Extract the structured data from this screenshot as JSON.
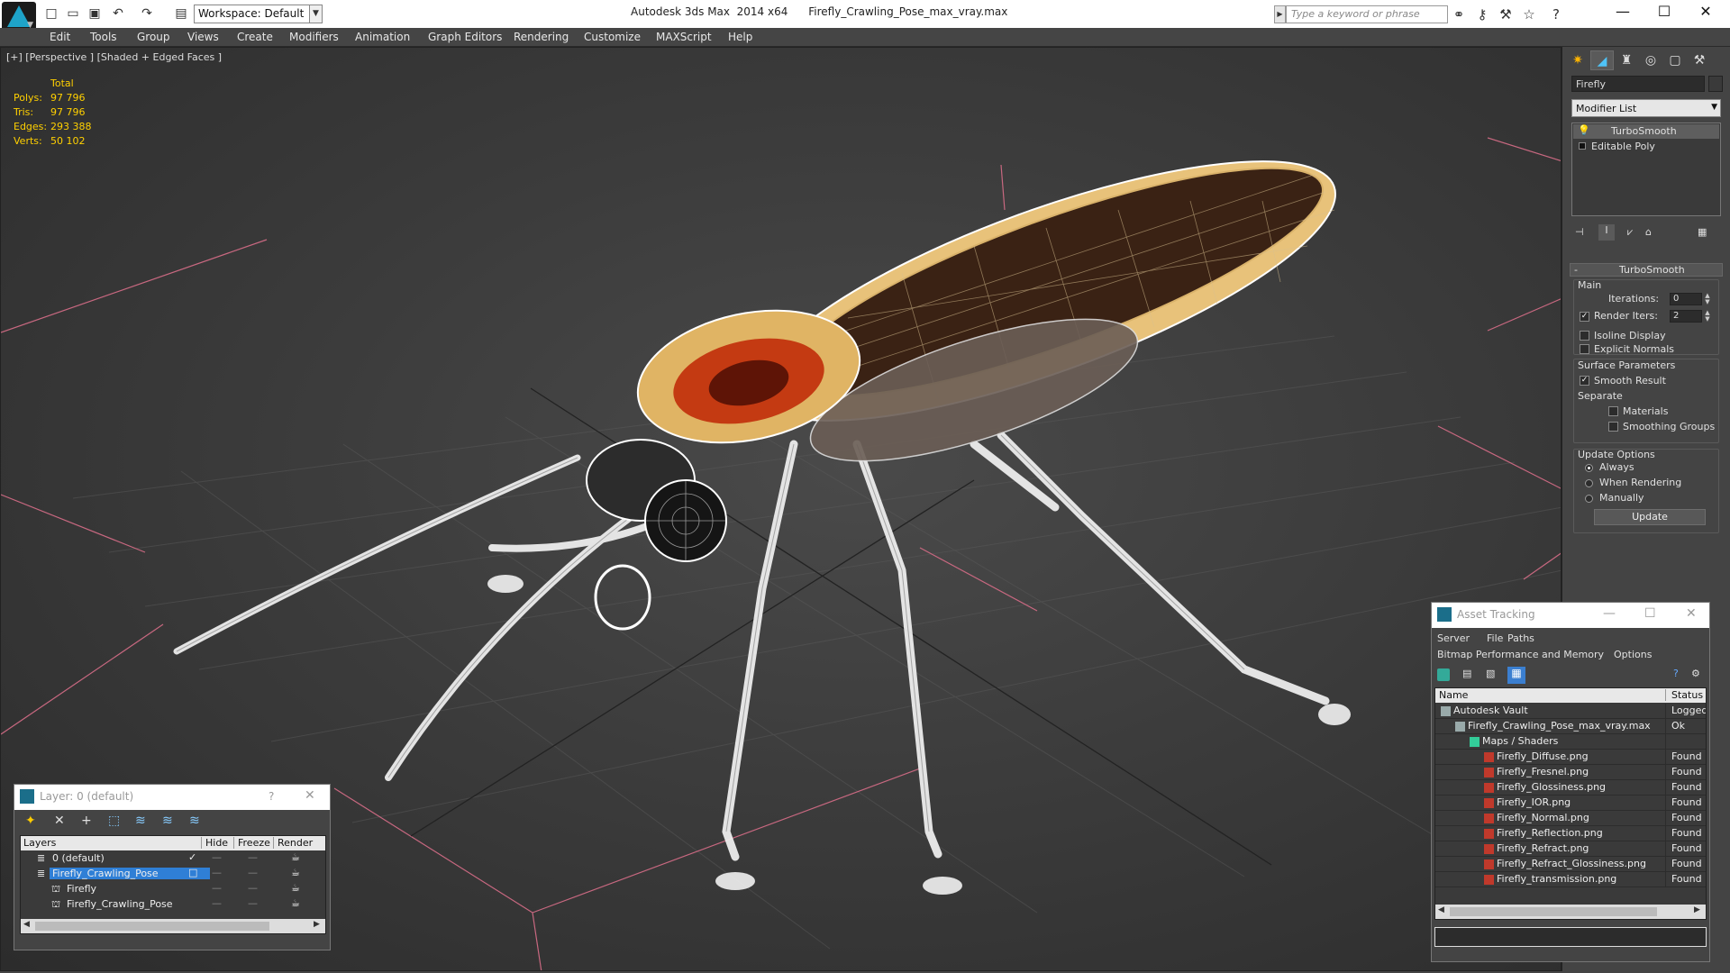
{
  "title_bar": {
    "app_title": "Autodesk 3ds Max  2014 x64      Firefly_Crawling_Pose_max_vray.max",
    "workspace": "Workspace: Default",
    "search_placeholder": "Type a keyword or phrase",
    "quick_access_icons": [
      "new-file-icon",
      "open-file-icon",
      "save-icon",
      "undo-icon",
      "redo-icon",
      "project-folder-icon"
    ],
    "toolbar_icons": [
      "binoculars-icon",
      "key-icon",
      "tools-icon",
      "star-icon",
      "help-icon"
    ],
    "window_controls": [
      "minimize",
      "maximize",
      "close"
    ],
    "window_control_glyphs": [
      "—",
      "☐",
      "✕"
    ]
  },
  "menu": {
    "items": [
      "Edit",
      "Tools",
      "Group",
      "Views",
      "Create",
      "Modifiers",
      "Animation",
      "Graph Editors",
      "Rendering",
      "Customize",
      "MAXScript",
      "Help"
    ]
  },
  "viewport": {
    "label": "[+] [Perspective ] [Shaded + Edged Faces ]",
    "stats": {
      "header": "Total",
      "rows": [
        {
          "label": "Polys:",
          "value": "97 796"
        },
        {
          "label": "Tris:",
          "value": "97 796"
        },
        {
          "label": "Edges:",
          "value": "293 388"
        },
        {
          "label": "Verts:",
          "value": "50 102"
        }
      ]
    },
    "stats_color": "#ffd000",
    "grid_color": "#c86880"
  },
  "command_panel": {
    "tabs": [
      "create-icon",
      "modify-icon",
      "hierarchy-icon",
      "motion-icon",
      "display-icon",
      "utilities-icon"
    ],
    "object_name": "Firefly",
    "modifier_list": "Modifier List",
    "stack": [
      "TurboSmooth",
      "Editable Poly"
    ],
    "rollout_title": "TurboSmooth",
    "main": {
      "title": "Main",
      "iterations_label": "Iterations:",
      "iterations_value": "0",
      "render_iters_label": "Render Iters:",
      "render_iters_value": "2",
      "render_iters_checked": true,
      "isoline": "Isoline Display",
      "explicit_normals": "Explicit Normals"
    },
    "surface": {
      "title": "Surface Parameters",
      "smooth_result": "Smooth Result",
      "separate": "Separate",
      "materials": "Materials",
      "smoothing_groups": "Smoothing Groups"
    },
    "update": {
      "title": "Update Options",
      "options": [
        "Always",
        "When Rendering",
        "Manually"
      ],
      "selected": "Always",
      "button": "Update"
    }
  },
  "asset_tracking": {
    "title": "Asset Tracking",
    "menus": [
      "Server",
      "File",
      "Paths"
    ],
    "menus2": [
      "Bitmap Performance and Memory",
      "Options"
    ],
    "columns": [
      "Name",
      "Status"
    ],
    "rows": [
      {
        "name": "Autodesk Vault",
        "status": "Logged O",
        "indent": 0,
        "icon": "vault-icon"
      },
      {
        "name": "Firefly_Crawling_Pose_max_vray.max",
        "status": "Ok",
        "indent": 1,
        "icon": "max-file-icon"
      },
      {
        "name": "Maps / Shaders",
        "status": "",
        "indent": 2,
        "icon": "maps-icon"
      },
      {
        "name": "Firefly_Diffuse.png",
        "status": "Found",
        "indent": 3,
        "icon": "png-icon"
      },
      {
        "name": "Firefly_Fresnel.png",
        "status": "Found",
        "indent": 3,
        "icon": "png-icon"
      },
      {
        "name": "Firefly_Glossiness.png",
        "status": "Found",
        "indent": 3,
        "icon": "png-icon"
      },
      {
        "name": "Firefly_IOR.png",
        "status": "Found",
        "indent": 3,
        "icon": "png-icon"
      },
      {
        "name": "Firefly_Normal.png",
        "status": "Found",
        "indent": 3,
        "icon": "png-icon"
      },
      {
        "name": "Firefly_Reflection.png",
        "status": "Found",
        "indent": 3,
        "icon": "png-icon"
      },
      {
        "name": "Firefly_Refract.png",
        "status": "Found",
        "indent": 3,
        "icon": "png-icon"
      },
      {
        "name": "Firefly_Refract_Glossiness.png",
        "status": "Found",
        "indent": 3,
        "icon": "png-icon"
      },
      {
        "name": "Firefly_transmission.png",
        "status": "Found",
        "indent": 3,
        "icon": "png-icon"
      }
    ]
  },
  "layer_manager": {
    "title": "Layer: 0 (default)",
    "help": "?",
    "toolbar_icons": [
      "new-layer-icon",
      "delete-layer-icon",
      "add-to-layer-icon",
      "select-in-layer-icon",
      "highlight-layer-icon",
      "hide-all-icon",
      "freeze-all-icon"
    ],
    "columns": [
      "Layers",
      "Hide",
      "Freeze",
      "Render"
    ],
    "rows": [
      {
        "name": "0 (default)",
        "indent": 0,
        "selected": false,
        "current": true
      },
      {
        "name": "Firefly_Crawling_Pose",
        "indent": 0,
        "selected": true,
        "current": false
      },
      {
        "name": "Firefly",
        "indent": 1,
        "selected": false,
        "current": false
      },
      {
        "name": "Firefly_Crawling_Pose",
        "indent": 1,
        "selected": false,
        "current": false
      }
    ]
  }
}
